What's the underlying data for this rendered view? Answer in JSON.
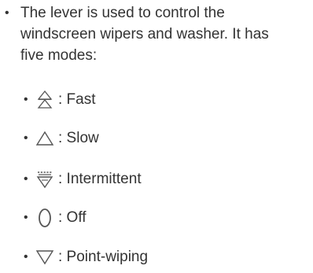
{
  "intro": {
    "bullet": "•",
    "text": "The lever is used to control the windscreen wipers and washer. It has five modes:"
  },
  "modes": [
    {
      "icon": "double-triangle-up-icon",
      "label": ": Fast"
    },
    {
      "icon": "triangle-up-icon",
      "label": ": Slow"
    },
    {
      "icon": "intermittent-wiper-icon",
      "label": ": Intermittent"
    },
    {
      "icon": "zero-off-icon",
      "label": ": Off"
    },
    {
      "icon": "triangle-down-icon",
      "label": ": Point-wiping"
    }
  ],
  "colors": {
    "text": "#333333",
    "icon": "#555555"
  }
}
